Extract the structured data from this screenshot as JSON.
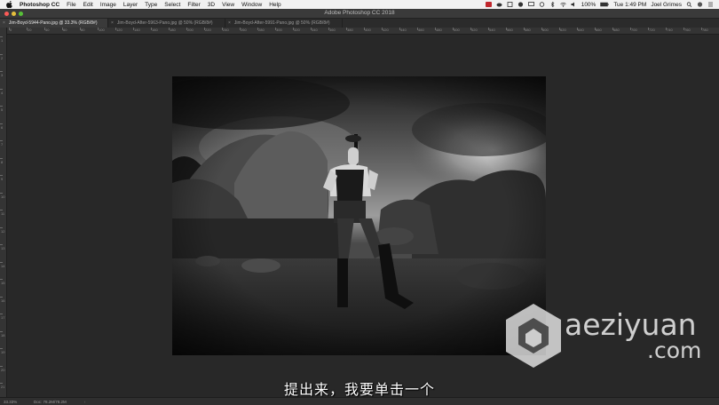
{
  "menubar": {
    "app_name": "Photoshop CC",
    "menus": [
      "File",
      "Edit",
      "Image",
      "Layer",
      "Type",
      "Select",
      "Filter",
      "3D",
      "View",
      "Window",
      "Help"
    ],
    "battery": "100%",
    "clock": "Tue 1:49 PM",
    "user": "Joel Grimes",
    "icons": [
      "record-icon",
      "cloud-icon",
      "script-icon",
      "creative-cloud-icon",
      "display-icon",
      "sync-icon",
      "bluetooth-icon",
      "wifi-icon",
      "volume-icon",
      "battery-icon",
      "search-icon",
      "siri-icon",
      "notification-icon"
    ]
  },
  "window": {
    "title": "Adobe Photoshop CC 2018",
    "traffic_lights": {
      "close": "#fc5b57",
      "minimize": "#e5bf3c",
      "zoom": "#57c038"
    }
  },
  "tabs": [
    {
      "label": "Jim-Boyd-5944-Pano.jpg @ 33.3% (RGB/8#)",
      "active": true
    },
    {
      "label": "Jim-Boyd-After-5963-Pano.jpg @ 50% (RGB/8#)",
      "active": false
    },
    {
      "label": "Jim-Boyd-After-5991-Pano.jpg @ 50% (RGB/8#)",
      "active": false
    }
  ],
  "ruler_top_labels": [
    "0",
    "20",
    "40",
    "60",
    "80",
    "100",
    "120",
    "140",
    "160",
    "180",
    "200",
    "220",
    "240",
    "260",
    "280",
    "300",
    "320",
    "340",
    "360",
    "380",
    "400",
    "420",
    "440",
    "460",
    "480",
    "500",
    "520",
    "540",
    "560",
    "580",
    "600",
    "620",
    "640",
    "660",
    "680",
    "700",
    "720",
    "740",
    "760",
    "780"
  ],
  "ruler_left_labels": [
    "1",
    "2",
    "3",
    "4",
    "5",
    "6",
    "7",
    "8",
    "9",
    "10",
    "11",
    "12",
    "13",
    "14",
    "15",
    "16",
    "17",
    "18",
    "19",
    "20",
    "21"
  ],
  "statusbar": {
    "zoom": "33.33%",
    "doc": "Doc: 78.2M/78.2M"
  },
  "subtitle": "提出来，我要单击一个",
  "watermark": {
    "line1": "aeziyuan",
    "line2": ".com"
  },
  "photo": {
    "description_icon": "bw-photo-man-with-rifle"
  }
}
